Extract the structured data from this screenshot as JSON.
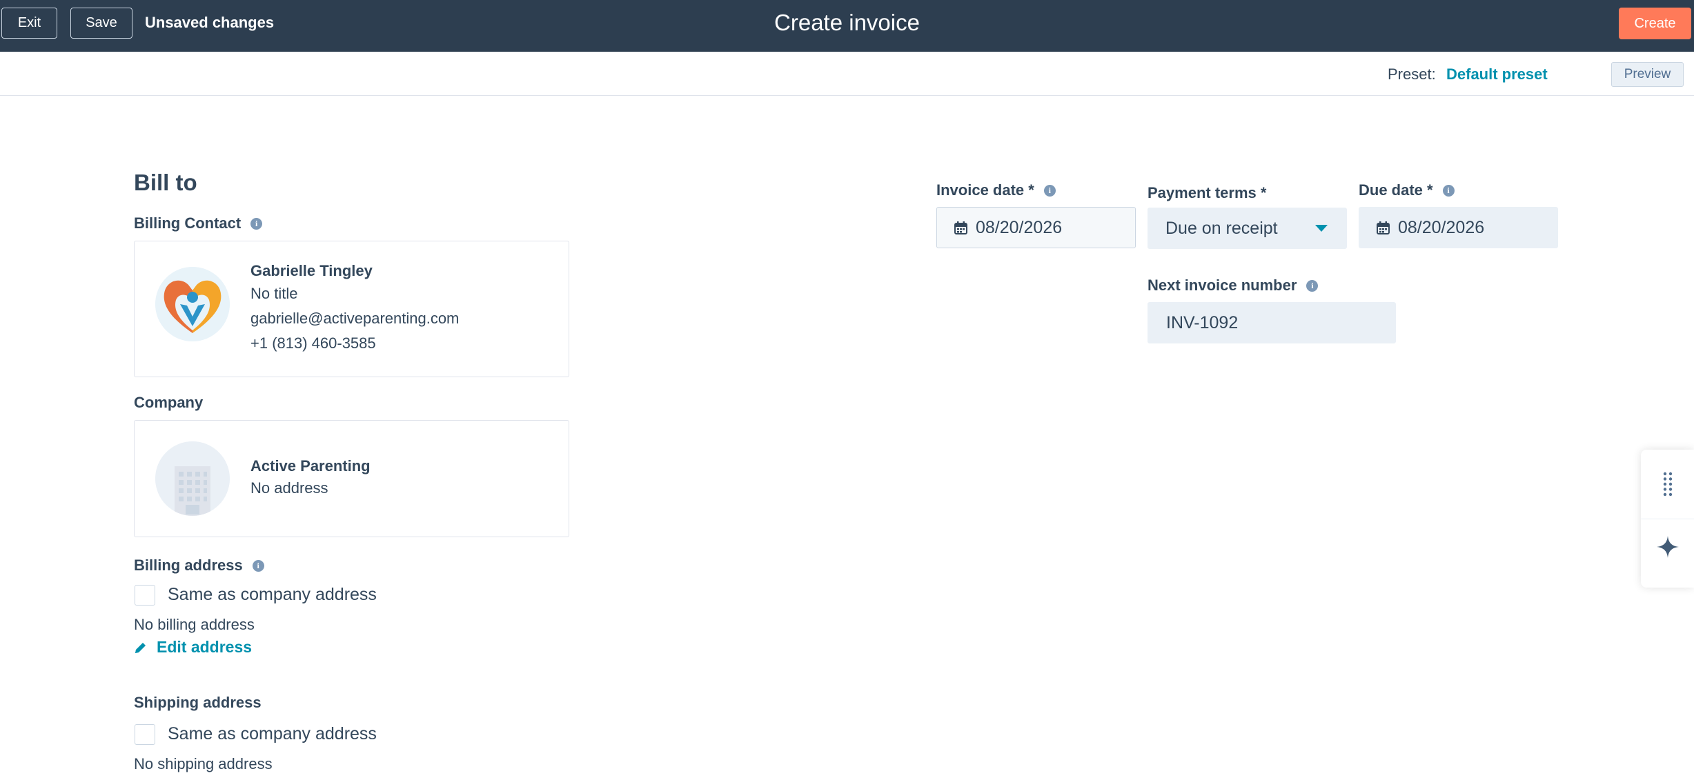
{
  "topbar": {
    "exit_label": "Exit",
    "save_label": "Save",
    "status": "Unsaved changes",
    "title": "Create invoice",
    "create_label": "Create"
  },
  "preset": {
    "label": "Preset:",
    "value": "Default preset",
    "preview_label": "Preview"
  },
  "bill_to": {
    "heading": "Bill to",
    "billing_contact_label": "Billing Contact",
    "contact": {
      "name": "Gabrielle Tingley",
      "title": "No title",
      "email": "gabrielle@activeparenting.com",
      "phone": "+1 (813) 460-3585"
    },
    "company_label": "Company",
    "company": {
      "name": "Active Parenting",
      "address": "No address"
    },
    "billing_address_label": "Billing address",
    "billing_same_label": "Same as company address",
    "billing_same_checked": false,
    "billing_address_value": "No billing address",
    "edit_address_label": "Edit address",
    "shipping_address_label": "Shipping address",
    "shipping_same_label": "Same as company address",
    "shipping_same_checked": false,
    "shipping_address_value": "No shipping address"
  },
  "invoice": {
    "invoice_date_label": "Invoice date *",
    "invoice_date": "08/20/2026",
    "payment_terms_label": "Payment terms *",
    "payment_terms": "Due on receipt",
    "due_date_label": "Due date *",
    "due_date": "08/20/2026",
    "next_number_label": "Next invoice number",
    "next_number": "INV-1092"
  },
  "colors": {
    "topbar": "#2d3e50",
    "accent": "#ff7a59",
    "link": "#0091ae",
    "text": "#33475b"
  },
  "icons": [
    "info-icon",
    "calendar-icon",
    "caret-down-icon",
    "pencil-icon",
    "drag-handle-icon",
    "sparkle-icon",
    "building-icon"
  ]
}
